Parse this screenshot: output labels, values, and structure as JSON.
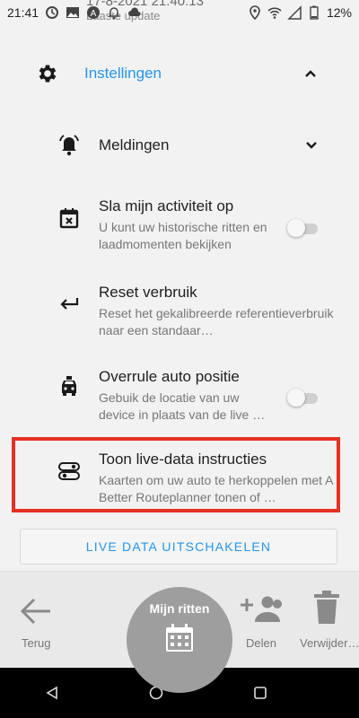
{
  "status_bar": {
    "time": "21:41",
    "battery": "12%",
    "icons": [
      "alarm-icon",
      "image-icon",
      "a-icon",
      "bell-icon",
      "cloud-icon",
      "location-icon",
      "wifi-icon",
      "signal-icon",
      "battery-icon"
    ]
  },
  "last_update": {
    "timestamp": "17-8-2021 21:40:13",
    "label": "Laaste update"
  },
  "settings": {
    "title": "Instellingen",
    "accent_color": "#2196f3"
  },
  "rows": [
    {
      "title": "Meldingen",
      "icon": "bell-ring-icon"
    },
    {
      "title": "Sla mijn activiteit op",
      "desc": "U kunt uw historische ritten en laadmomenten bekijken",
      "toggle_on": false,
      "icon": "calendar-x-icon"
    },
    {
      "title": "Reset verbruik",
      "desc": "Reset het gekalibreerde referentieverbruik naar een standaar…",
      "icon": "return-arrow-icon"
    },
    {
      "title": "Overrule auto positie",
      "desc": "Gebuik de locatie van uw device in plaats van de live …",
      "toggle_on": false,
      "icon": "taxi-icon"
    },
    {
      "title": "Toon live-data instructies",
      "desc": "Kaarten om uw auto te herkoppelen met A Better Routeplanner tonen of …",
      "icon": "route-icon"
    }
  ],
  "live_button": "LIVE DATA UITSCHAKELEN",
  "bottom_bar": {
    "back": "Terug",
    "my_trips": "Mijn ritten",
    "share": "Delen",
    "delete": "Verwijder…"
  },
  "highlight_color": "#e53022"
}
